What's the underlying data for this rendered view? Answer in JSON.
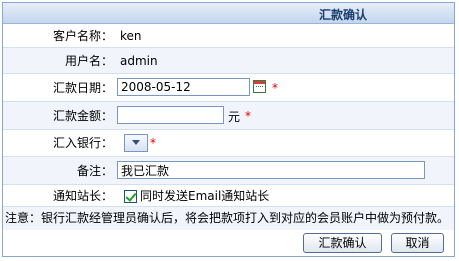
{
  "panel": {
    "title": "汇款确认"
  },
  "form": {
    "customer_name": {
      "label": "客户名称：",
      "value": "ken"
    },
    "username": {
      "label": "用户名：",
      "value": "admin"
    },
    "date": {
      "label": "汇款日期：",
      "value": "2008-05-12",
      "required": "*"
    },
    "amount": {
      "label": "汇款金额：",
      "value": "",
      "unit": "元",
      "required": "*"
    },
    "bank": {
      "label": "汇入银行：",
      "value": "",
      "required": "*"
    },
    "remark": {
      "label": "备注：",
      "value": "我已汇款"
    },
    "notify": {
      "label": "通知站长：",
      "checkbox_label": "同时发送Email通知站长",
      "checked": true
    }
  },
  "notice": "注意：银行汇款经管理员确认后，将会把款项打入到对应的会员账户中做为预付款。",
  "buttons": {
    "confirm": "汇款确认",
    "cancel": "取消"
  },
  "colors": {
    "border": "#86a8cf",
    "title_text": "#1b3d6e",
    "required": "#e00000",
    "row_alt": "#f1f5fb"
  },
  "icons": {
    "calendar": "calendar-icon",
    "dropdown": "chevron-down-icon",
    "check": "checkbox-checked"
  }
}
